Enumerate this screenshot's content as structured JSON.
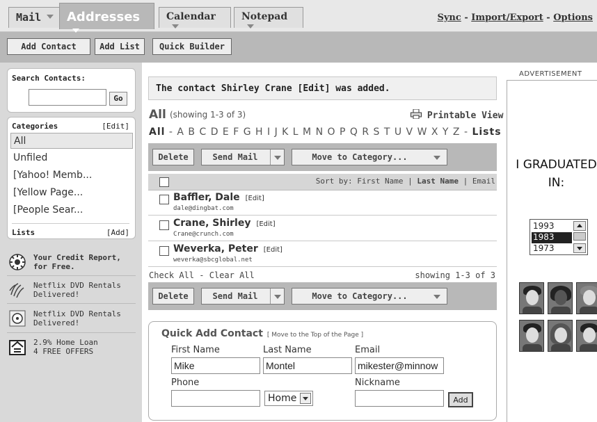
{
  "tabs": {
    "mail": "Mail",
    "addresses": "Addresses",
    "calendar": "Calendar",
    "notepad": "Notepad"
  },
  "toplinks": {
    "sync": "Sync",
    "sep1": " - ",
    "import_export": "Import/Export",
    "sep2": " - ",
    "options": "Options"
  },
  "toolbar": {
    "add_contact": "Add Contact",
    "add_list": "Add List",
    "quick_builder": "Quick Builder"
  },
  "sidebar": {
    "search_label": "Search Contacts:",
    "search_value": "",
    "go": "Go",
    "categories_label": "Categories",
    "categories_edit": "[Edit]",
    "categories": [
      "All",
      "Unfiled",
      "[Yahoo! Memb...",
      "[Yellow Page...",
      "[People Sear..."
    ],
    "lists_label": "Lists",
    "lists_add": "[Add]",
    "promos": [
      {
        "line1": "Your Credit Report,",
        "line2": "for Free.",
        "icon": "credit-report-icon"
      },
      {
        "line1": "Netflix DVD Rentals",
        "line2": "Delivered!",
        "icon": "netflix-icon"
      },
      {
        "line1": "Netflix DVD Rentals",
        "line2": "Delivered!",
        "icon": "dvd-icon"
      },
      {
        "line1": "2.9% Home Loan",
        "line2": "4 FREE OFFERS",
        "icon": "home-loan-icon"
      }
    ]
  },
  "main": {
    "message_prefix": "The contact Shirley Crane ",
    "message_edit": "[Edit]",
    "message_suffix": " was added.",
    "title": "All",
    "showing": "(showing 1-3 of 3)",
    "printable": "Printable View",
    "alpha_all": "All",
    "alpha_dash1": " - ",
    "alpha_letters": "A B C D E F G H I J K L M N O P Q R S T U V W X Y Z",
    "alpha_dash2": " - ",
    "alpha_lists": "Lists",
    "delete": "Delete",
    "send_mail": "Send Mail",
    "move_to_category": "Move to Category...",
    "sort_prefix": "Sort by: First Name | ",
    "sort_last": "Last Name",
    "sort_suffix": " | Email",
    "contacts": [
      {
        "name": "Baffler, Dale",
        "edit": "[Edit]",
        "email": "dale@dingbat.com"
      },
      {
        "name": "Crane, Shirley",
        "edit": "[Edit]",
        "email": "Crane@crunch.com"
      },
      {
        "name": "Weverka, Peter",
        "edit": "[Edit]",
        "email": "weverka@sbcglobal.net"
      }
    ],
    "check_all": "Check All",
    "check_sep": " - ",
    "clear_all": "Clear All",
    "showing_bottom": "showing 1-3 of 3"
  },
  "quick_add": {
    "title": "Quick Add Contact",
    "move_top": "[ Move to the Top of the Page ]",
    "first_name_label": "First Name",
    "first_name_value": "Mike",
    "last_name_label": "Last Name",
    "last_name_value": "Montel",
    "email_label": "Email",
    "email_value": "mikester@minnow",
    "phone_label": "Phone",
    "phone_value": "",
    "phone_type": "Home",
    "nickname_label": "Nickname",
    "nickname_value": "",
    "add": "Add"
  },
  "ad": {
    "label": "ADVERTISEMENT",
    "line1": "I GRADUATED",
    "line2": "IN:",
    "years": [
      "1993",
      "1983",
      "1973"
    ],
    "selected_year": "1983"
  }
}
